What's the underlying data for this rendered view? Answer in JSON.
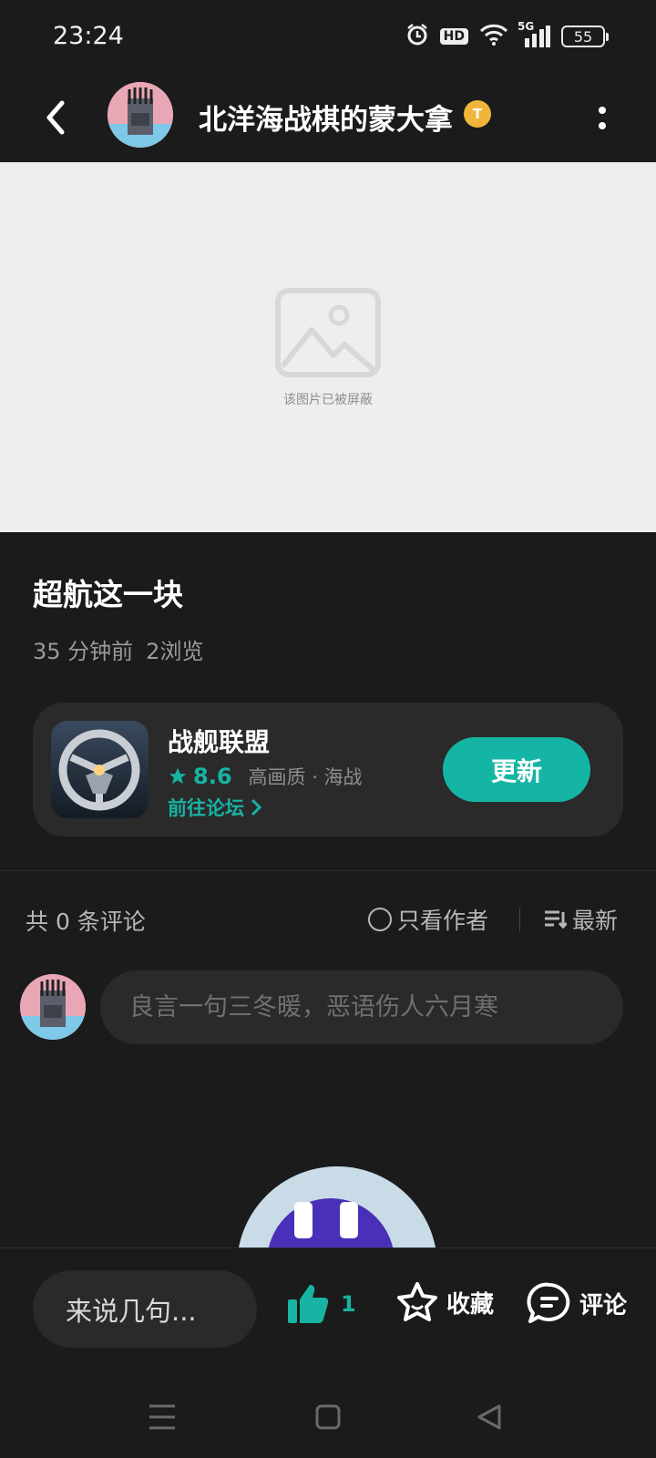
{
  "status_bar": {
    "time": "23:24",
    "hd_label": "HD",
    "network_label": "5G",
    "battery": "55",
    "icons": [
      "alarm-icon",
      "hd-icon",
      "wifi-icon",
      "signal-icon",
      "battery-icon"
    ]
  },
  "header": {
    "title": "北洋海战棋的蒙大拿",
    "badge": "T",
    "icons": [
      "back-icon",
      "avatar",
      "coin-badge-icon",
      "more-icon"
    ]
  },
  "blocked_image": {
    "text": "该图片已被屏蔽",
    "icon": "image-placeholder-icon"
  },
  "post": {
    "title": "超航这一块",
    "time_ago": "35 分钟前",
    "views": "2浏览"
  },
  "game_card": {
    "name": "战舰联盟",
    "rating": "8.6",
    "tags": "高画质 · 海战",
    "forum_link": "前往论坛",
    "update_label": "更新",
    "accent_color": "#15b5a6"
  },
  "comments": {
    "count_text": "共 0 条评论",
    "author_only": "只看作者",
    "sort": "最新",
    "placeholder": "良言一句三冬暖，恶语伤人六月寒"
  },
  "action_bar": {
    "say_placeholder": "来说几句...",
    "like_count": "1",
    "favorite_label": "收藏",
    "comment_label": "评论"
  },
  "system_nav": {
    "icons": [
      "menu-icon",
      "home-icon",
      "back-triangle-icon"
    ]
  }
}
